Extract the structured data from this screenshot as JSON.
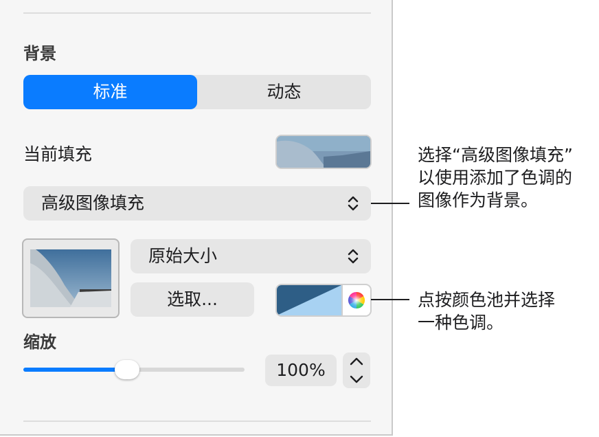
{
  "background_section": {
    "title": "背景",
    "segments": [
      "标准",
      "动态"
    ],
    "selected_segment": "标准"
  },
  "current_fill": {
    "label": "当前填充"
  },
  "fill_type_popup": {
    "value": "高级图像填充"
  },
  "image_options": {
    "scale_mode_popup": "原始大小",
    "choose_button": "选取...",
    "tint_color": "#2e5e86",
    "tint_light_color": "#a8d2f2"
  },
  "scale_section": {
    "title": "缩放",
    "value": "100%",
    "slider_level": 0.47
  },
  "callouts": {
    "fill_popup_note": [
      "选择“高级图像填充”",
      "以使用添加了色调的",
      "图像作为背景。"
    ],
    "tint_note": [
      "点按颜色池并选择",
      "一种色调。"
    ]
  },
  "colors": {
    "accent": "#0a7cff"
  }
}
